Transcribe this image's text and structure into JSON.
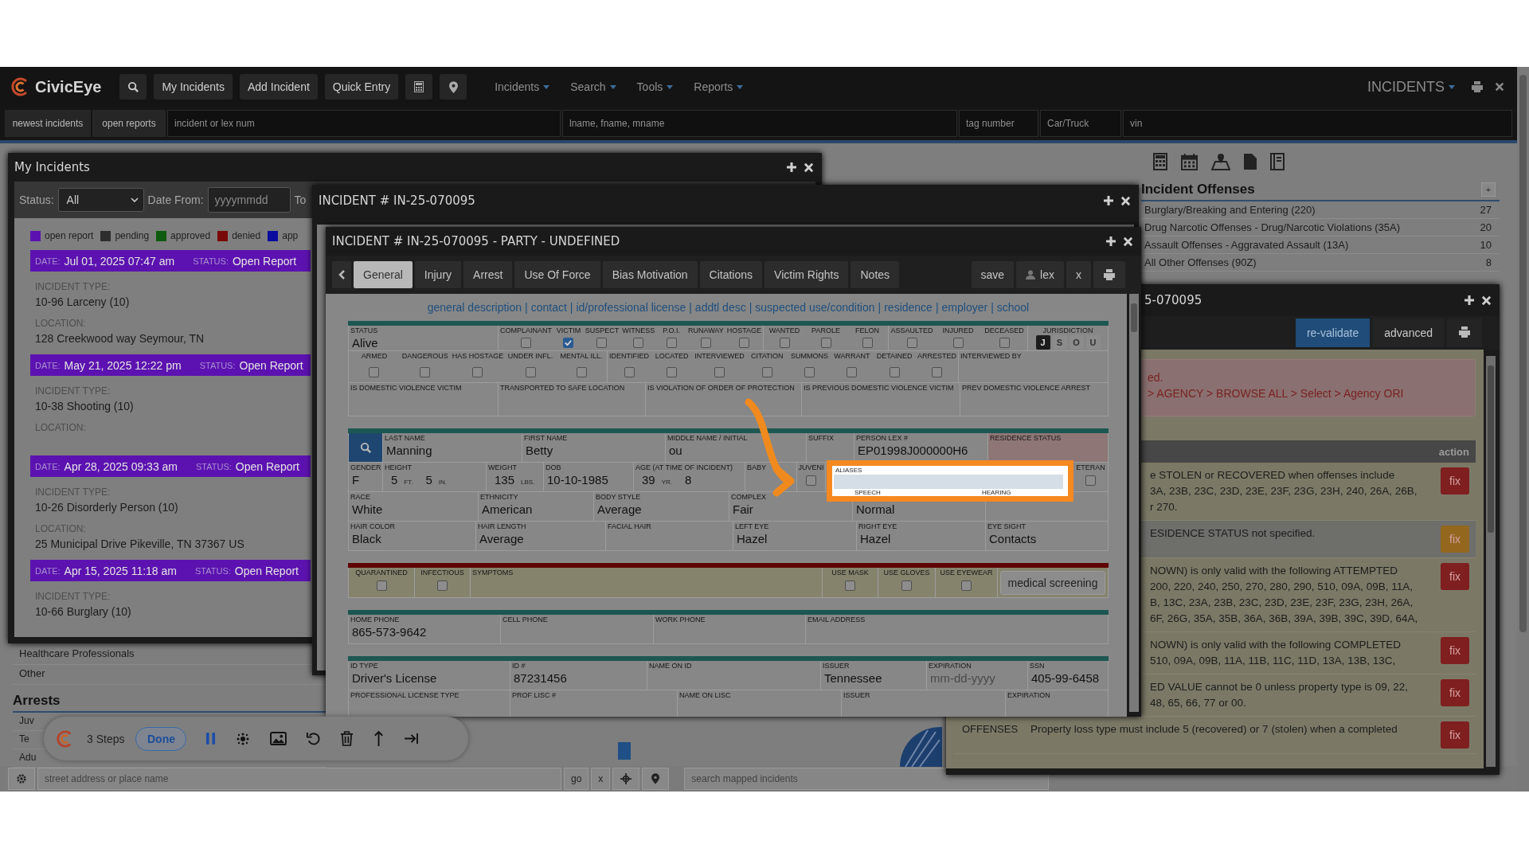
{
  "app": {
    "logo": "CivicEye",
    "nav_buttons": [
      "My Incidents",
      "Add Incident",
      "Quick Entry"
    ],
    "menus": [
      "Incidents",
      "Search",
      "Tools",
      "Reports"
    ],
    "module": "INCIDENTS"
  },
  "search_row": [
    {
      "kind": "button",
      "text": "newest incidents"
    },
    {
      "kind": "button",
      "text": "open reports"
    },
    {
      "kind": "field",
      "placeholder": "incident or lex num"
    },
    {
      "kind": "field",
      "placeholder": "lname, fname, mname"
    },
    {
      "kind": "field",
      "placeholder": "tag number"
    },
    {
      "kind": "field",
      "placeholder": "Car/Truck"
    },
    {
      "kind": "field",
      "placeholder": "vin"
    }
  ],
  "background": {
    "list": [
      "Healthcare Professionals",
      "Other"
    ],
    "arrests_title": "Arrests",
    "arrests": [
      "Juv",
      "Te",
      "Adu"
    ]
  },
  "my_incidents": {
    "title": "My Incidents",
    "status_label": "Status:",
    "status_value": "All",
    "date_from_label": "Date From:",
    "date_from_placeholder": "yyyymmdd",
    "to_label": "To",
    "legend": [
      {
        "label": "open report",
        "color": "#5c12b0"
      },
      {
        "label": "pending",
        "color": "#2e2e2e"
      },
      {
        "label": "approved",
        "color": "#0e5a0e"
      },
      {
        "label": "denied",
        "color": "#7a0a0a"
      },
      {
        "label": "app",
        "color": "#0a0aa0"
      }
    ],
    "cards": [
      {
        "date_label": "DATE:",
        "date": "Jul 01, 2025 07:47 am",
        "status_label": "STATUS:",
        "status": "Open Report",
        "type_label": "INCIDENT TYPE:",
        "type": "10-96 Larceny (10)",
        "location_label": "LOCATION:",
        "location": "128 Creekwood way Seymour, TN"
      },
      {
        "date_label": "DATE:",
        "date": "May 21, 2025 12:22 pm",
        "status_label": "STATUS:",
        "status": "Open Report",
        "type_label": "INCIDENT TYPE:",
        "type": "10-38 Shooting (10)",
        "location_label": "LOCATION:"
      },
      {
        "date_label": "DATE:",
        "date": "Apr 28, 2025 09:33 am",
        "status_label": "STATUS:",
        "status": "Open Report",
        "type_label": "INCIDENT TYPE:",
        "type": "10-26 Disorderly Person (10)",
        "location_label": "LOCATION:",
        "location": "25 Municipal Drive Pikeville, TN 37367 US"
      },
      {
        "date_label": "DATE:",
        "date": "Apr 15, 2025 11:18 am",
        "status_label": "STATUS:",
        "status": "Open Report",
        "type_label": "INCIDENT TYPE:",
        "type": "10-66 Burglary (10)"
      }
    ]
  },
  "offenses": {
    "title": "Incident Offenses",
    "add": "+",
    "rows": [
      {
        "name": "Burglary/Breaking and Entering (220)",
        "count": "27"
      },
      {
        "name": "Drug Narcotic Offenses - Drug/Narcotic Violations (35A)",
        "count": "20"
      },
      {
        "name": "Assault Offenses - Aggravated Assault (13A)",
        "count": "10"
      },
      {
        "name": "All Other Offenses (90Z)",
        "count": "8"
      }
    ]
  },
  "incident_window": {
    "title": "INCIDENT # IN-25-070095"
  },
  "party_window": {
    "title": "INCIDENT # IN-25-070095 - PARTY - UNDEFINED",
    "tabs": [
      {
        "label": "General",
        "selected": true
      },
      {
        "label": "Injury",
        "selected": false
      },
      {
        "label": "Arrest",
        "selected": false
      },
      {
        "label": "Use Of Force",
        "selected": false
      },
      {
        "label": "Bias Motivation",
        "selected": false
      },
      {
        "label": "Citations",
        "selected": false
      },
      {
        "label": "Victim Rights",
        "selected": false
      },
      {
        "label": "Notes",
        "selected": false
      }
    ],
    "actions": [
      "save",
      "lex",
      "x"
    ],
    "links": [
      "general description",
      "contact",
      "id/professional license",
      "addtl desc",
      "suspected use/condition",
      "residence",
      "employer",
      "school"
    ],
    "separator": "|",
    "general": {
      "status_label": "STATUS",
      "status": "Alive",
      "flag_groups": [
        [
          {
            "label": "COMPLAINANT",
            "checked": false
          },
          {
            "label": "VICTIM",
            "checked": true
          },
          {
            "label": "SUSPECT",
            "checked": false
          },
          {
            "label": "WITNESS",
            "checked": false
          },
          {
            "label": "P.O.I.",
            "checked": false
          },
          {
            "label": "RUNAWAY",
            "checked": false
          },
          {
            "label": "HOSTAGE",
            "checked": false
          }
        ],
        [
          {
            "label": "WANTED",
            "checked": false
          },
          {
            "label": "PAROLE",
            "checked": false
          },
          {
            "label": "FELON",
            "checked": false
          }
        ],
        [
          {
            "label": "ASSAULTED",
            "checked": false
          },
          {
            "label": "INJURED",
            "checked": false
          },
          {
            "label": "DECEASED",
            "checked": false
          }
        ]
      ],
      "jurisdiction_label": "JURISDICTION",
      "jurisdiction": [
        {
          "label": "J",
          "selected": true
        },
        {
          "label": "S",
          "selected": false
        },
        {
          "label": "O",
          "selected": false
        },
        {
          "label": "U",
          "selected": false
        }
      ],
      "flag_groups_2": [
        [
          {
            "label": "ARMED",
            "checked": false
          },
          {
            "label": "DANGEROUS",
            "checked": false
          },
          {
            "label": "HAS HOSTAGE",
            "checked": false
          },
          {
            "label": "UNDER INFL.",
            "checked": false
          },
          {
            "label": "MENTAL ILL.",
            "checked": false
          }
        ],
        [
          {
            "label": "IDENTIFIED",
            "checked": false
          },
          {
            "label": "LOCATED",
            "checked": false
          },
          {
            "label": "INTERVIEWED",
            "checked": false
          },
          {
            "label": "CITATION",
            "checked": false
          },
          {
            "label": "SUMMONS",
            "checked": false
          },
          {
            "label": "WARRANT",
            "checked": false
          },
          {
            "label": "DETAINED",
            "checked": false
          },
          {
            "label": "ARRESTED",
            "checked": false
          }
        ]
      ],
      "interviewed_by_label": "INTERVIEWED BY",
      "dv_labels": [
        "IS DOMESTIC VIOLENCE VICTIM",
        "TRANSPORTED TO SAFE LOCATION",
        "IS VIOLATION OF ORDER OF PROTECTION",
        "IS PREVIOUS DOMESTIC VIOLENCE VICTIM",
        "PREV DOMESTIC VIOLENCE ARREST"
      ]
    },
    "sections": [
      {
        "kind": "standard",
        "rows": [
          {
            "fields": [
              {
                "kind": "search"
              },
              {
                "kind": "text",
                "label": "LAST NAME",
                "value": "Manning"
              },
              {
                "kind": "text",
                "label": "FIRST NAME",
                "value": "Betty"
              },
              {
                "kind": "text",
                "label": "MIDDLE NAME / INITIAL",
                "value": "ou"
              },
              {
                "kind": "text",
                "label": "SUFFIX"
              },
              {
                "kind": "text",
                "label": "PERSON LEX #",
                "value": "EP01998J000000H6"
              },
              {
                "kind": "alert",
                "label": "RESIDENCE STATUS"
              }
            ]
          },
          {
            "fields": [
              {
                "kind": "text",
                "label": "GENDER",
                "value": "F"
              },
              {
                "kind": "measure",
                "label": "HEIGHT",
                "parts": [
                  {
                    "value": "5",
                    "unit": "FT."
                  },
                  {
                    "value": "5",
                    "unit": "IN."
                  }
                ]
              },
              {
                "kind": "measure",
                "label": "WEIGHT",
                "parts": [
                  {
                    "value": "135",
                    "unit": "LBS."
                  }
                ]
              },
              {
                "kind": "text",
                "label": "DOB",
                "value": "10-10-1985"
              },
              {
                "kind": "measure",
                "label": "AGE (AT TIME OF INCIDENT)",
                "parts": [
                  {
                    "value": "39",
                    "unit": "YR."
                  },
                  {
                    "value": "8"
                  }
                ]
              },
              {
                "kind": "text",
                "label": "BABY"
              },
              {
                "kind": "check",
                "label": "JUVENI",
                "checked": false
              },
              {
                "kind": "highlight",
                "label": "ALIASES",
                "sub_labels": [
                  "SPEECH",
                  "HEARING"
                ]
              },
              {
                "kind": "check",
                "label": "ETERAN",
                "checked": false
              }
            ]
          },
          {
            "fields": [
              {
                "kind": "text",
                "label": "RACE",
                "value": "White"
              },
              {
                "kind": "text",
                "label": "ETHNICITY",
                "value": "American"
              },
              {
                "kind": "text",
                "label": "BODY STYLE",
                "value": "Average"
              },
              {
                "kind": "text",
                "label": "COMPLEX",
                "value": "Fair"
              },
              {
                "kind": "text",
                "value": "Normal"
              },
              {
                "kind": "text"
              }
            ]
          },
          {
            "fields": [
              {
                "kind": "text",
                "label": "HAIR COLOR",
                "value": "Black"
              },
              {
                "kind": "text",
                "label": "HAIR LENGTH",
                "value": "Average"
              },
              {
                "kind": "text",
                "label": "FACIAL HAIR"
              },
              {
                "kind": "text",
                "label": "LEFT EYE",
                "value": "Hazel"
              },
              {
                "kind": "text",
                "label": "RIGHT EYE",
                "value": "Hazel"
              },
              {
                "kind": "text",
                "label": "EYE SIGHT",
                "value": "Contacts"
              }
            ]
          }
        ]
      },
      {
        "kind": "caution",
        "rows": [
          {
            "fields": [
              {
                "kind": "check",
                "label": "QUARANTINED",
                "checked": false
              },
              {
                "kind": "check",
                "label": "INFECTIOUS",
                "checked": false
              },
              {
                "kind": "text",
                "label": "SYMPTOMS"
              },
              {
                "kind": "check",
                "label": "USE MASK",
                "checked": false
              },
              {
                "kind": "check",
                "label": "USE GLOVES",
                "checked": false
              },
              {
                "kind": "check",
                "label": "USE EYEWEAR",
                "checked": false
              },
              {
                "kind": "button",
                "label": "medical screening"
              }
            ]
          }
        ]
      },
      {
        "kind": "standard",
        "rows": [
          {
            "fields": [
              {
                "kind": "text",
                "label": "HOME PHONE",
                "value": "865-573-9642"
              },
              {
                "kind": "text",
                "label": "CELL PHONE"
              },
              {
                "kind": "text",
                "label": "WORK PHONE"
              },
              {
                "kind": "text",
                "label": "EMAIL ADDRESS"
              }
            ]
          }
        ]
      },
      {
        "kind": "standard",
        "rows": [
          {
            "fields": [
              {
                "kind": "text",
                "label": "ID TYPE",
                "value": "Driver's License"
              },
              {
                "kind": "text",
                "label": "ID #",
                "value": "87231456"
              },
              {
                "kind": "text",
                "label": "NAME ON ID"
              },
              {
                "kind": "text",
                "label": "ISSUER",
                "value": "Tennessee"
              },
              {
                "kind": "text",
                "label": "EXPIRATION",
                "placeholder": "mm-dd-yyyy"
              },
              {
                "kind": "text",
                "label": "SSN",
                "value": "405-99-6458"
              }
            ]
          },
          {
            "fields": [
              {
                "kind": "text",
                "label": "PROFESSIONAL LICENSE TYPE"
              },
              {
                "kind": "text",
                "label": "PROF LISC #"
              },
              {
                "kind": "text",
                "label": "NAME ON LISC"
              },
              {
                "kind": "text",
                "label": "ISSUER"
              },
              {
                "kind": "text",
                "label": "EXPIRATION"
              }
            ]
          }
        ]
      }
    ]
  },
  "validation_window": {
    "title": "5-070095",
    "buttons": [
      "re-validate",
      "advanced"
    ],
    "error_lines": [
      "ed.",
      "> AGENCY > BROWSE ALL > Select > Agency ORI"
    ],
    "action_header": "action",
    "rows": [
      {
        "kind": "error",
        "lines": [
          "e STOLEN or RECOVERED when offenses include",
          "3A, 23B, 23C, 23D, 23E, 23F, 23G, 23H, 240, 26A, 26B,",
          "r 270."
        ],
        "fix": "fix"
      },
      {
        "kind": "warning",
        "lines": [
          "ESIDENCE STATUS not specified."
        ],
        "fix": "fix"
      },
      {
        "kind": "error",
        "lines": [
          "NOWN) is only valid with the following ATTEMPTED",
          "200, 220, 240, 250, 270, 280, 290, 510, 09A, 09B, 11A,",
          "B, 13C, 23A, 23B, 23C, 23D, 23E, 23F, 23G, 23H, 26A,",
          "6F, 26G, 35A, 35B, 36A, 36B, 39A, 39B, 39C, 39D, 64A,"
        ],
        "fix": "fix"
      },
      {
        "kind": "error",
        "lines": [
          "NOWN) is only valid with the following COMPLETED",
          "510, 09A, 09B, 11A, 11B, 11C, 11D, 13A, 13B, 13C,"
        ],
        "fix": "fix"
      },
      {
        "kind": "error",
        "lines": [
          "ED VALUE cannot be 0 unless property type is 09, 22,",
          "48, 65, 66, 77 or 00."
        ],
        "fix": "fix"
      },
      {
        "kind": "error",
        "label": "OFFENSES",
        "lines": [
          "Property loss type must include 5 (recovered) or 7 (stolen) when a completed"
        ],
        "fix": "fix"
      }
    ]
  },
  "steps_toolbar": {
    "count": "3 Steps",
    "done": "Done"
  },
  "map_bar": {
    "address_placeholder": "street address or place name",
    "go": "go",
    "clear": "x",
    "search_placeholder": "search mapped incidents"
  }
}
